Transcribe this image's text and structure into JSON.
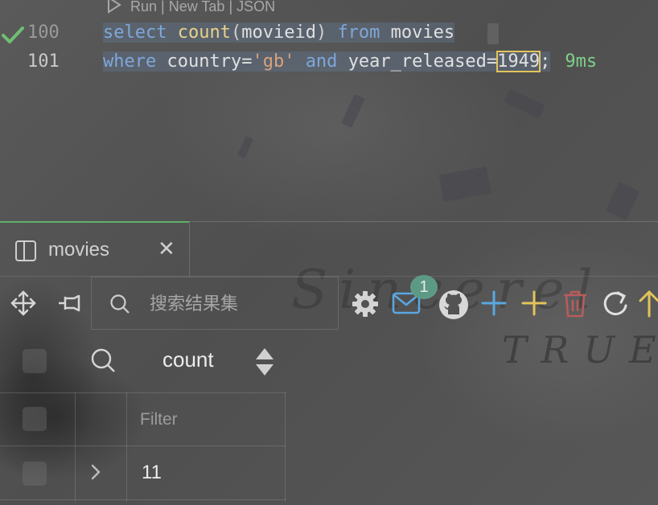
{
  "editor": {
    "codelens": {
      "run": "Run",
      "sep1": " | ",
      "new_tab": "New Tab",
      "sep2": " | ",
      "json": "JSON"
    },
    "lines": [
      {
        "number": "100",
        "tokens": {
          "kw1": "select",
          "fn": "count",
          "p_open": "(",
          "arg": "movieid",
          "p_close": ")",
          "kw2": "from",
          "table": "movies"
        }
      },
      {
        "number": "101",
        "tokens": {
          "kw1": "where",
          "col1": "country",
          "eq1": "=",
          "str": "'gb'",
          "kw2": "and",
          "col2": "year_released",
          "eq2": "=",
          "num": "1949",
          "semi": ";"
        }
      }
    ],
    "exec_time": "9ms"
  },
  "result_panel": {
    "tab_label": "movies",
    "close_glyph": "✕",
    "search_placeholder": "搜索结果集",
    "notification_count": "1",
    "column_header": "count",
    "filter_placeholder": "Filter",
    "rows": [
      {
        "count": "11"
      }
    ]
  },
  "watermark": {
    "script": "Sincerel",
    "true": "TRUE"
  },
  "colors": {
    "accent_green": "#5fb06a",
    "add_blue": "#5aa7e0",
    "add_yellow": "#e2c45a",
    "delete_red": "#b85c5c",
    "badge": "#5d9a86"
  }
}
